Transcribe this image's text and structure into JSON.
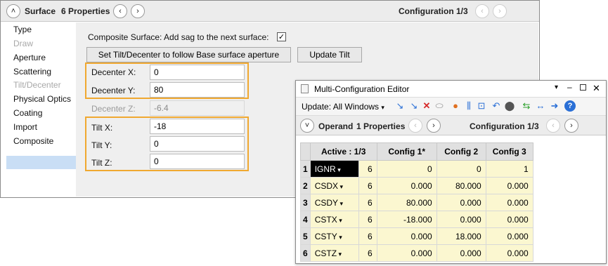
{
  "surface_panel": {
    "title": "Surface",
    "properties": "6 Properties",
    "config": "Configuration 1/3",
    "sidebar": [
      {
        "label": "Type",
        "disabled": false
      },
      {
        "label": "Draw",
        "disabled": true
      },
      {
        "label": "Aperture",
        "disabled": false
      },
      {
        "label": "Scattering",
        "disabled": false
      },
      {
        "label": "Tilt/Decenter",
        "disabled": true
      },
      {
        "label": "Physical Optics",
        "disabled": false
      },
      {
        "label": "Coating",
        "disabled": false
      },
      {
        "label": "Import",
        "disabled": false
      },
      {
        "label": "Composite",
        "disabled": false,
        "selected": true
      }
    ],
    "composite_label": "Composite Surface: Add sag to the next surface:",
    "composite_checked": "✓",
    "set_tilt_button": "Set Tilt/Decenter to follow Base surface aperture",
    "update_tilt_button": "Update Tilt",
    "fields": {
      "decenter_x": {
        "label": "Decenter X:",
        "value": "0"
      },
      "decenter_y": {
        "label": "Decenter Y:",
        "value": "80"
      },
      "decenter_z": {
        "label": "Decenter Z:",
        "value": "-6.4"
      },
      "tilt_x": {
        "label": "Tilt X:",
        "value": "-18"
      },
      "tilt_y": {
        "label": "Tilt Y:",
        "value": "0"
      },
      "tilt_z": {
        "label": "Tilt Z:",
        "value": "0"
      }
    }
  },
  "mce": {
    "title": "Multi-Configuration Editor",
    "update": "Update: All Windows",
    "operand": "Operand",
    "properties": "1 Properties",
    "config": "Configuration 1/3",
    "table": {
      "headers": [
        "Active : 1/3",
        "Config 1*",
        "Config 2",
        "Config 3"
      ],
      "rows": [
        {
          "num": "1",
          "op": "IGNR",
          "param": "6",
          "c1": "0",
          "c2": "0",
          "c3": "1"
        },
        {
          "num": "2",
          "op": "CSDX",
          "param": "6",
          "c1": "0.000",
          "c2": "80.000",
          "c3": "0.000"
        },
        {
          "num": "3",
          "op": "CSDY",
          "param": "6",
          "c1": "80.000",
          "c2": "0.000",
          "c3": "0.000"
        },
        {
          "num": "4",
          "op": "CSTX",
          "param": "6",
          "c1": "-18.000",
          "c2": "0.000",
          "c3": "0.000"
        },
        {
          "num": "5",
          "op": "CSTY",
          "param": "6",
          "c1": "0.000",
          "c2": "18.000",
          "c3": "0.000"
        },
        {
          "num": "6",
          "op": "CSTZ",
          "param": "6",
          "c1": "0.000",
          "c2": "0.000",
          "c3": "0.000"
        }
      ]
    }
  },
  "colors": {
    "highlight_box": "#f0a830",
    "cell_bg": "#fbf7d0",
    "selected_side": "#c9def5"
  }
}
